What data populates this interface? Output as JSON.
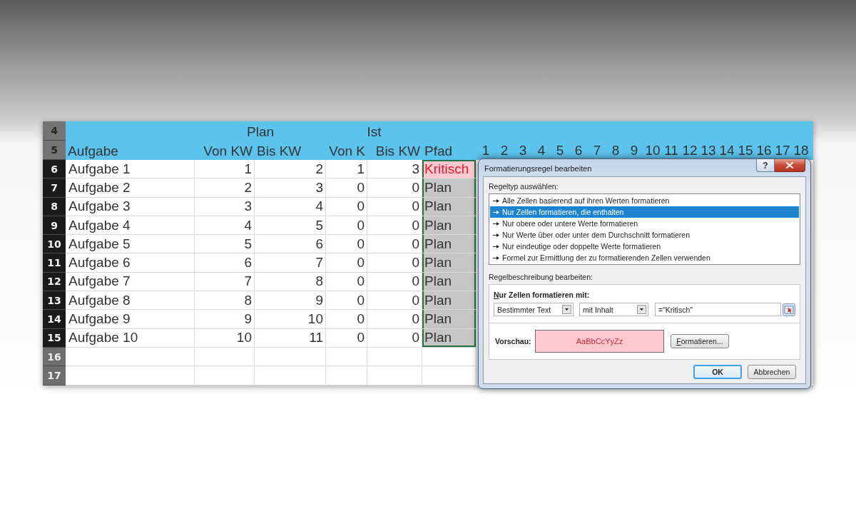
{
  "sheet": {
    "group_row": {
      "number": "4",
      "groups": [
        {
          "label": "Plan"
        },
        {
          "label": "Ist"
        }
      ]
    },
    "header_row": {
      "number": "5",
      "columns": [
        "Aufgabe",
        "Von KW",
        "Bis KW",
        "Von K",
        "Bis KW",
        "Pfad"
      ],
      "weeks": [
        "1",
        "2",
        "3",
        "4",
        "5",
        "6",
        "7",
        "8",
        "9",
        "10",
        "11",
        "12",
        "13",
        "14",
        "15",
        "16",
        "17",
        "18"
      ]
    },
    "rows": [
      {
        "number": "6",
        "cells": [
          "Aufgabe 1",
          "1",
          "2",
          "1",
          "3"
        ],
        "status": "Kritisch",
        "critical": true,
        "status_selected": true
      },
      {
        "number": "7",
        "cells": [
          "Aufgabe 2",
          "2",
          "3",
          "0",
          "0"
        ],
        "status": "Plan",
        "critical": false,
        "status_selected": true
      },
      {
        "number": "8",
        "cells": [
          "Aufgabe 3",
          "3",
          "4",
          "0",
          "0"
        ],
        "status": "Plan",
        "critical": false,
        "status_selected": true
      },
      {
        "number": "9",
        "cells": [
          "Aufgabe 4",
          "4",
          "5",
          "0",
          "0"
        ],
        "status": "Plan",
        "critical": false,
        "status_selected": true
      },
      {
        "number": "10",
        "cells": [
          "Aufgabe 5",
          "5",
          "6",
          "0",
          "0"
        ],
        "status": "Plan",
        "critical": false,
        "status_selected": true
      },
      {
        "number": "11",
        "cells": [
          "Aufgabe 6",
          "6",
          "7",
          "0",
          "0"
        ],
        "status": "Plan",
        "critical": false,
        "status_selected": true
      },
      {
        "number": "12",
        "cells": [
          "Aufgabe 7",
          "7",
          "8",
          "0",
          "0"
        ],
        "status": "Plan",
        "critical": false,
        "status_selected": true
      },
      {
        "number": "13",
        "cells": [
          "Aufgabe 8",
          "8",
          "9",
          "0",
          "0"
        ],
        "status": "Plan",
        "critical": false,
        "status_selected": true
      },
      {
        "number": "14",
        "cells": [
          "Aufgabe 9",
          "9",
          "10",
          "0",
          "0"
        ],
        "status": "Plan",
        "critical": false,
        "status_selected": true
      },
      {
        "number": "15",
        "cells": [
          "Aufgabe 10",
          "10",
          "11",
          "0",
          "0"
        ],
        "status": "Plan",
        "critical": false,
        "status_selected": true
      }
    ],
    "empty_rows": [
      {
        "number": "16"
      },
      {
        "number": "17"
      }
    ]
  },
  "dialog": {
    "title": "Formatierungsregel bearbeiten",
    "help_button": "?",
    "rule_type_label": "Regeltyp auswählen:",
    "rule_types": [
      {
        "label": "Alle Zellen basierend auf ihren Werten formatieren",
        "selected": false
      },
      {
        "label": "Nur Zellen formatieren, die enthalten",
        "selected": true
      },
      {
        "label": "Nur obere oder untere Werte formatieren",
        "selected": false
      },
      {
        "label": "Nur Werte über oder unter dem Durchschnitt formatieren",
        "selected": false
      },
      {
        "label": "Nur eindeutige oder doppelte Werte formatieren",
        "selected": false
      },
      {
        "label": "Formel zur Ermittlung der zu formatierenden Zellen verwenden",
        "selected": false
      }
    ],
    "description_label": "Regelbeschreibung bearbeiten:",
    "condition_heading": "Nur Zellen formatieren mit:",
    "condition_fields": [
      {
        "kind": "dropdown",
        "value": "Bestimmter Text"
      },
      {
        "kind": "dropdown",
        "value": "mit Inhalt"
      },
      {
        "kind": "text",
        "value": "=\"Kritisch\""
      }
    ],
    "preview_label": "Vorschau:",
    "preview_sample": "AaBbCcYyZz",
    "format_button": "Formatieren...",
    "buttons": [
      {
        "label": "OK",
        "default": true
      },
      {
        "label": "Abbrechen",
        "default": false
      }
    ]
  }
}
